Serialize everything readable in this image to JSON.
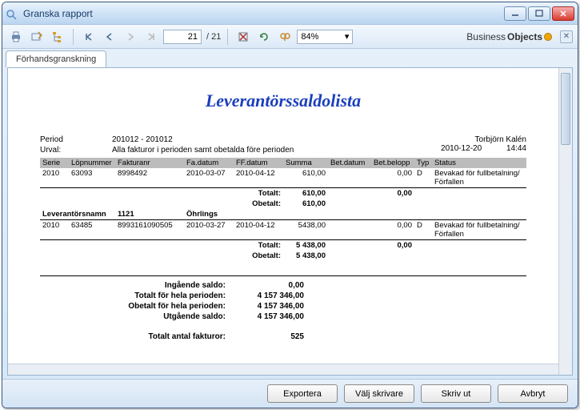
{
  "window": {
    "title": "Granska rapport"
  },
  "toolbar": {
    "page_current": "21",
    "page_total": "/ 21",
    "zoom": "84%"
  },
  "logo": {
    "part1": "Business",
    "part2": "Objects"
  },
  "tab": {
    "label": "Förhandsgranskning"
  },
  "report": {
    "title": "Leverantörssaldolista",
    "user": "Torbjörn Kalén",
    "date": "2010-12-20",
    "time": "14:44",
    "period_label": "Period",
    "period_value": "201012 - 201012",
    "urval_label": "Urval:",
    "urval_value": "Alla fakturor i perioden samt obetalda före perioden",
    "headers": {
      "serie": "Serie",
      "lopnr": "Löpnummer",
      "faktnr": "Fakturanr",
      "fadatum": "Fa.datum",
      "ffdatum": "FF.datum",
      "summa": "Summa",
      "betdatum": "Bet.datum",
      "betbelopp": "Bet.belopp",
      "typ": "Typ",
      "status": "Status"
    },
    "rows": [
      {
        "serie": "2010",
        "lop": "63093",
        "fakt": "8998492",
        "fa": "2010-03-07",
        "ff": "2010-04-12",
        "summa": "610,00",
        "betd": "",
        "betb": "0,00",
        "typ": "D",
        "status": "Bevakad för fullbetalning/ Förfallen"
      }
    ],
    "sub1": {
      "total_lbl": "Totalt:",
      "total_val": "610,00",
      "obet_lbl": "Obetalt:",
      "obet_val": "610,00",
      "betsum": "0,00"
    },
    "supplier": {
      "label": "Leverantörsnamn",
      "nr": "1121",
      "name": "Öhrlings"
    },
    "rows2": [
      {
        "serie": "2010",
        "lop": "63485",
        "fakt": "8993161090505",
        "fa": "2010-03-27",
        "ff": "2010-04-12",
        "summa": "5438,00",
        "betd": "",
        "betb": "0,00",
        "typ": "D",
        "status": "Bevakad för fullbetalning/ Förfallen"
      }
    ],
    "sub2": {
      "total_lbl": "Totalt:",
      "total_val": "5 438,00",
      "obet_lbl": "Obetalt:",
      "obet_val": "5 438,00",
      "betsum": "0,00"
    },
    "summary": {
      "ing_lbl": "Ingående saldo:",
      "ing_val": "0,00",
      "totper_lbl": "Totalt för hela perioden:",
      "totper_val": "4 157 346,00",
      "obeper_lbl": "Obetalt för hela perioden:",
      "obeper_val": "4 157 346,00",
      "utg_lbl": "Utgående saldo:",
      "utg_val": "4 157 346,00",
      "antal_lbl": "Totalt antal fakturor:",
      "antal_val": "525"
    }
  },
  "buttons": {
    "export": "Exportera",
    "printer": "Välj skrivare",
    "print": "Skriv ut",
    "cancel": "Avbryt"
  }
}
